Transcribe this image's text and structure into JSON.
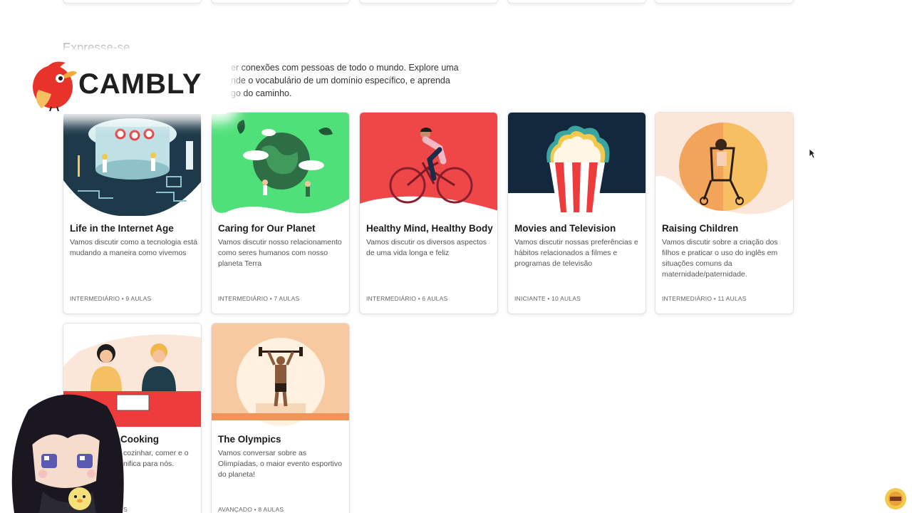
{
  "brand": {
    "name": "CAMBLY",
    "bird_color": "#e8332a"
  },
  "section": {
    "title": "Expresse-se",
    "description_lines": [
      "er conexões com pessoas de todo o mundo. Explore uma",
      "nde o vocabulário de um domínio específico, e aprenda",
      "go do caminho."
    ]
  },
  "courses": [
    {
      "title": "Life in the Internet Age",
      "description": "Vamos discutir como a tecnologia está mudando a maneira como vivemos",
      "meta": "INTERMEDIÁRIO • 9 AULAS",
      "icon": "internet-age-illustration",
      "color": "#1e3a4a"
    },
    {
      "title": "Caring for Our Planet",
      "description": "Vamos discutir nosso relacionamento como seres humanos com nosso planeta Terra",
      "meta": "INTERMEDIÁRIO • 7 AULAS",
      "icon": "planet-earth-illustration",
      "color": "#4fe07a"
    },
    {
      "title": "Healthy Mind, Healthy Body",
      "description": "Vamos discutir os diversos aspectos de uma vida longa e feliz",
      "meta": "INTERMEDIÁRIO • 6 AULAS",
      "icon": "cyclist-illustration",
      "color": "#ef4748"
    },
    {
      "title": "Movies and Television",
      "description": "Vamos discutir nossas preferências e hábitos relacionados a filmes e programas de televisão",
      "meta": "INICIANTE • 10 AULAS",
      "icon": "popcorn-illustration",
      "color": "#13273d"
    },
    {
      "title": "Raising Children",
      "description": "Vamos discutir sobre a criação dos filhos e praticar o uso do inglês em situações comuns da maternidade/paternidade.",
      "meta": "INTERMEDIÁRIO • 11 AULAS",
      "icon": "stroller-illustration",
      "color": "#f2a45a"
    },
    {
      "title": "Cooking",
      "description": "cozinhar, comer e o nifica para nós.",
      "meta": "S",
      "icon": "cooking-illustration",
      "color": "#ee3b3b"
    },
    {
      "title": "The Olympics",
      "description": "Vamos conversar sobre as Olimpíadas, o maior evento esportivo do planeta!",
      "meta": "AVANÇADO • 8 AULAS",
      "icon": "weightlifter-illustration",
      "color": "#f7c9a0"
    }
  ]
}
